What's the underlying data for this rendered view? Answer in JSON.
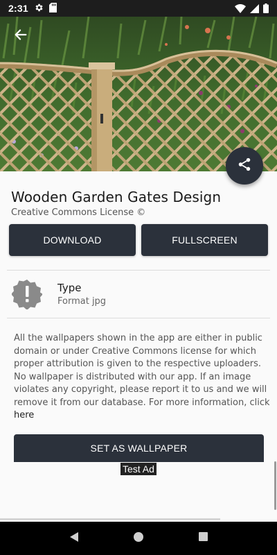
{
  "status_bar": {
    "time": "2:31",
    "icons": [
      "gear-icon",
      "sd-card-icon",
      "wifi-icon",
      "signal-icon",
      "battery-icon"
    ]
  },
  "hero": {
    "back_icon": "arrow-back-icon",
    "share_icon": "share-icon"
  },
  "wallpaper": {
    "title": "Wooden Garden Gates Design",
    "license": "Creative Commons License ©"
  },
  "actions": {
    "download_label": "DOWNLOAD",
    "fullscreen_label": "FULLSCREEN",
    "set_wallpaper_label": "SET AS WALLPAPER"
  },
  "details": {
    "type_label": "Type",
    "type_value": "Format jpg",
    "type_icon": "alert-badge-icon"
  },
  "info": {
    "text": "All the wallpapers shown in the app are either in public domain or under Creative Commons license for which proper attribution is given to the respective uploaders. No wallpaper is distributed with our app. If an image violates any copyright, please report it to us and we will remove it from our database. For more information, click",
    "link_text": "here"
  },
  "ad": {
    "label": "Test Ad"
  },
  "colors": {
    "primary_dark": "#2b313b",
    "status_bar": "#1d1d1d",
    "background": "#fafafa"
  },
  "nav_bar": {
    "icons": [
      "back-triangle-icon",
      "home-circle-icon",
      "recents-square-icon"
    ]
  }
}
